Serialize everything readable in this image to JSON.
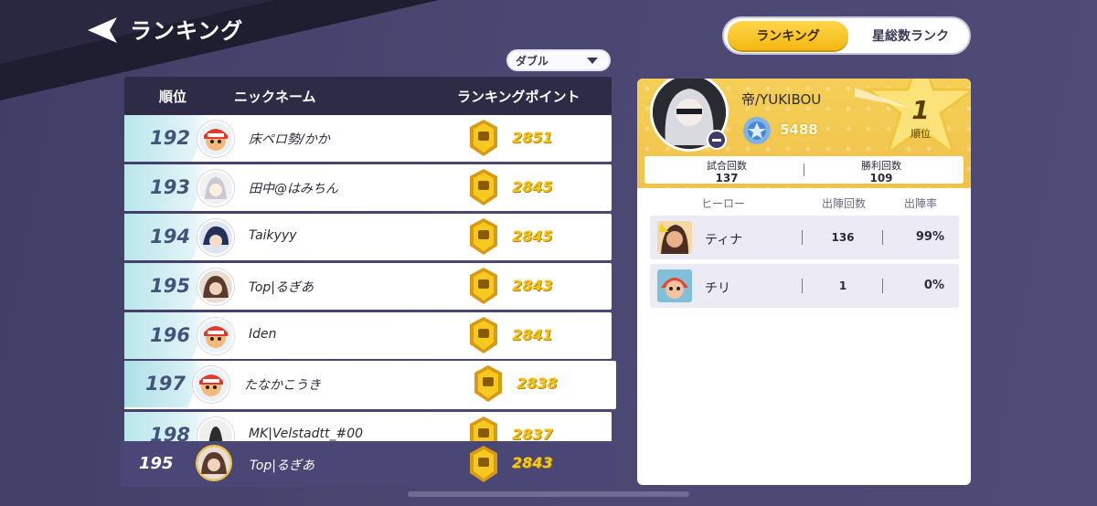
{
  "header": {
    "title": "ランキング"
  },
  "mode_dropdown": {
    "selected": "ダブル"
  },
  "view_toggle": {
    "active": "ランキング",
    "inactive": "星総数ランク"
  },
  "table": {
    "headers": {
      "rank": "順位",
      "nickname": "ニックネーム",
      "points": "ランキングポイント"
    },
    "rows": [
      {
        "rank": "192",
        "name": "床ペロ勢/かか",
        "points": "2851"
      },
      {
        "rank": "193",
        "name": "田中@はみちん",
        "points": "2845"
      },
      {
        "rank": "194",
        "name": "Taikyyy",
        "points": "2845"
      },
      {
        "rank": "195",
        "name": "Top|るぎあ",
        "points": "2843"
      },
      {
        "rank": "196",
        "name": "Iden",
        "points": "2841"
      },
      {
        "rank": "197",
        "name": "たなかこうき",
        "points": "2838"
      },
      {
        "rank": "198",
        "name": "MK|Velstadtt_#00",
        "points": "2837"
      }
    ]
  },
  "self_row": {
    "rank": "195",
    "name": "Top|るぎあ",
    "points": "2843"
  },
  "player_card": {
    "name": "帝/YUKIBOU",
    "stars": "5488",
    "star_rank": "1",
    "star_rank_label": "順位",
    "stats": {
      "matches_label": "試合回数",
      "matches_value": "137",
      "wins_label": "勝利回数",
      "wins_value": "109"
    },
    "hero_headers": {
      "hero": "ヒーロー",
      "appearances": "出陣回数",
      "rate": "出陣率"
    },
    "heroes": [
      {
        "name": "ティナ",
        "count": "136",
        "rate": "99%"
      },
      {
        "name": "チリ",
        "count": "1",
        "rate": "0%"
      }
    ]
  },
  "colors": {
    "background": "#494770",
    "accent_gold": "#f5c91f",
    "highlight_row": "#4a4675",
    "table_header": "#2d2b46"
  }
}
